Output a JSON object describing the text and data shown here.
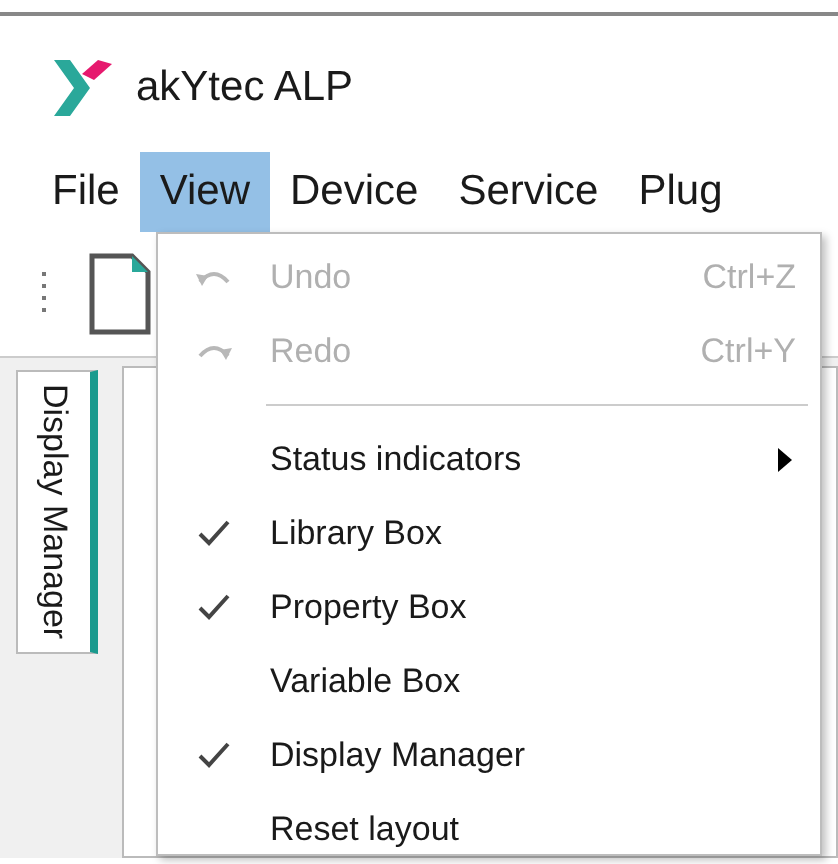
{
  "app": {
    "title": "akYtec ALP"
  },
  "menu_bar": [
    {
      "label": "File",
      "selected": false
    },
    {
      "label": "View",
      "selected": true
    },
    {
      "label": "Device",
      "selected": false
    },
    {
      "label": "Service",
      "selected": false
    },
    {
      "label": "Plug",
      "selected": false
    }
  ],
  "side_tab": {
    "label": "Display Manager"
  },
  "view_menu": [
    {
      "kind": "undo",
      "label": "Undo",
      "shortcut": "Ctrl+Z",
      "disabled": true
    },
    {
      "kind": "redo",
      "label": "Redo",
      "shortcut": "Ctrl+Y",
      "disabled": true
    },
    {
      "kind": "separator"
    },
    {
      "kind": "submenu",
      "label": "Status indicators",
      "disabled": false
    },
    {
      "kind": "toggle",
      "label": "Library Box",
      "checked": true,
      "disabled": false
    },
    {
      "kind": "toggle",
      "label": "Property Box",
      "checked": true,
      "disabled": false
    },
    {
      "kind": "toggle",
      "label": "Variable Box",
      "checked": false,
      "disabled": false
    },
    {
      "kind": "toggle",
      "label": "Display Manager",
      "checked": true,
      "disabled": false
    },
    {
      "kind": "command",
      "label": "Reset layout",
      "disabled": false
    }
  ]
}
